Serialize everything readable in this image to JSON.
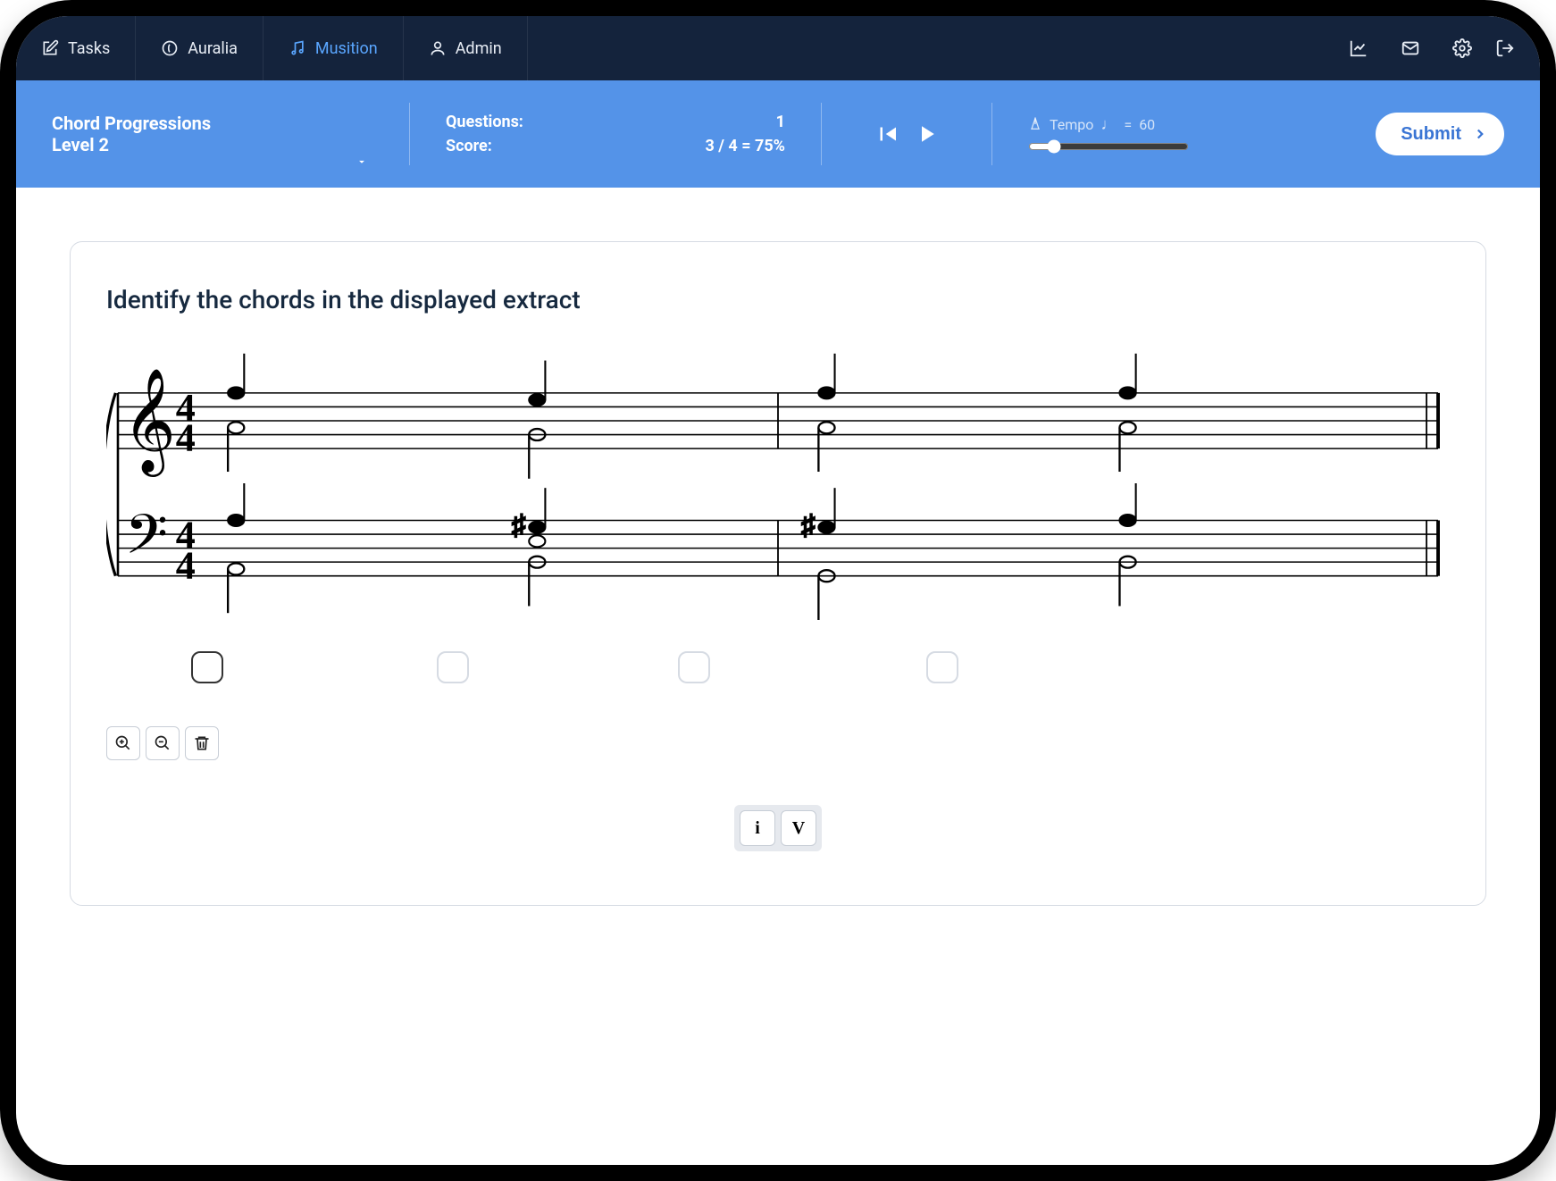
{
  "nav": {
    "tasks": "Tasks",
    "auralia": "Auralia",
    "musition": "Musition",
    "admin": "Admin"
  },
  "subheader": {
    "topic_title": "Chord Progressions",
    "topic_level": "Level 2",
    "questions_label": "Questions:",
    "questions_value": "1",
    "score_label": "Score:",
    "score_value": "3 / 4 = 75%",
    "tempo_label": "Tempo",
    "tempo_value": "60",
    "submit": "Submit"
  },
  "question": {
    "prompt": "Identify the chords in the displayed extract",
    "time_signature": "4/4",
    "answer_slots": 4,
    "roman_options": [
      "i",
      "V"
    ]
  }
}
